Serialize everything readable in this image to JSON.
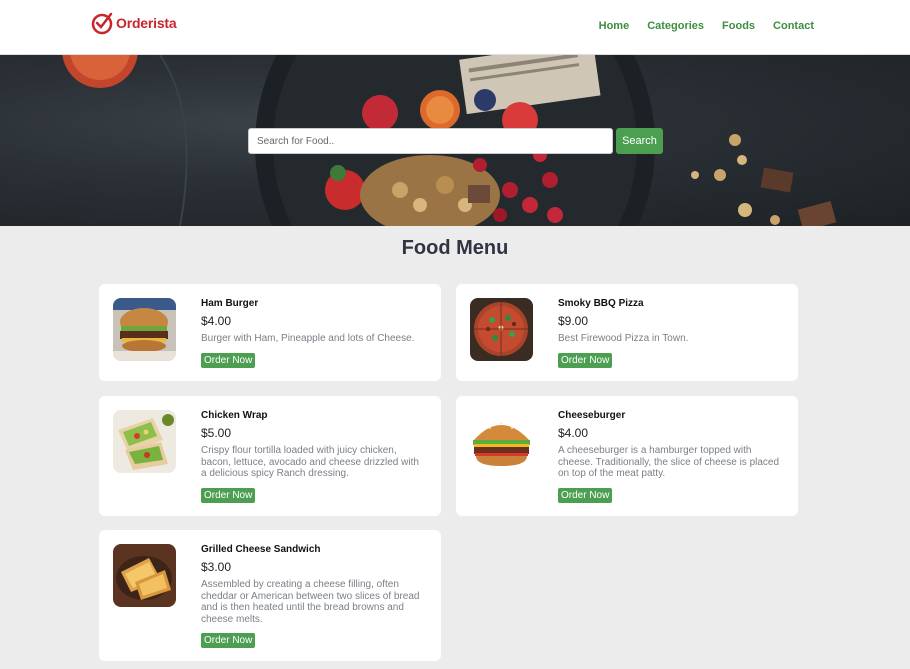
{
  "brand": {
    "name": "Orderista",
    "accent": "#c8262b"
  },
  "nav": {
    "items": [
      "Home",
      "Categories",
      "Foods",
      "Contact"
    ],
    "color": "#3e8e41"
  },
  "search": {
    "placeholder": "Search for Food..",
    "button_label": "Search",
    "button_color": "#4c9f50"
  },
  "menu": {
    "title": "Food Menu",
    "order_label": "Order Now",
    "items": [
      {
        "name": "Ham Burger",
        "price": "$4.00",
        "description": "Burger with Ham, Pineapple and lots of Cheese.",
        "icon": "burger-image"
      },
      {
        "name": "Smoky BBQ Pizza",
        "price": "$9.00",
        "description": "Best Firewood Pizza in Town.",
        "icon": "pizza-image"
      },
      {
        "name": "Chicken Wrap",
        "price": "$5.00",
        "description": "Crispy flour tortilla loaded with juicy chicken, bacon, lettuce, avocado and cheese drizzled with a delicious spicy Ranch dressing.",
        "icon": "wrap-image"
      },
      {
        "name": "Cheeseburger",
        "price": "$4.00",
        "description": "A cheeseburger is a hamburger topped with cheese. Traditionally, the slice of cheese is placed on top of the meat patty.",
        "icon": "cheeseburger-image"
      },
      {
        "name": "Grilled Cheese Sandwich",
        "price": "$3.00",
        "description": "Assembled by creating a cheese filling, often cheddar or American between two slices of bread and is then heated until the bread browns and cheese melts.",
        "icon": "sandwich-image"
      }
    ]
  }
}
